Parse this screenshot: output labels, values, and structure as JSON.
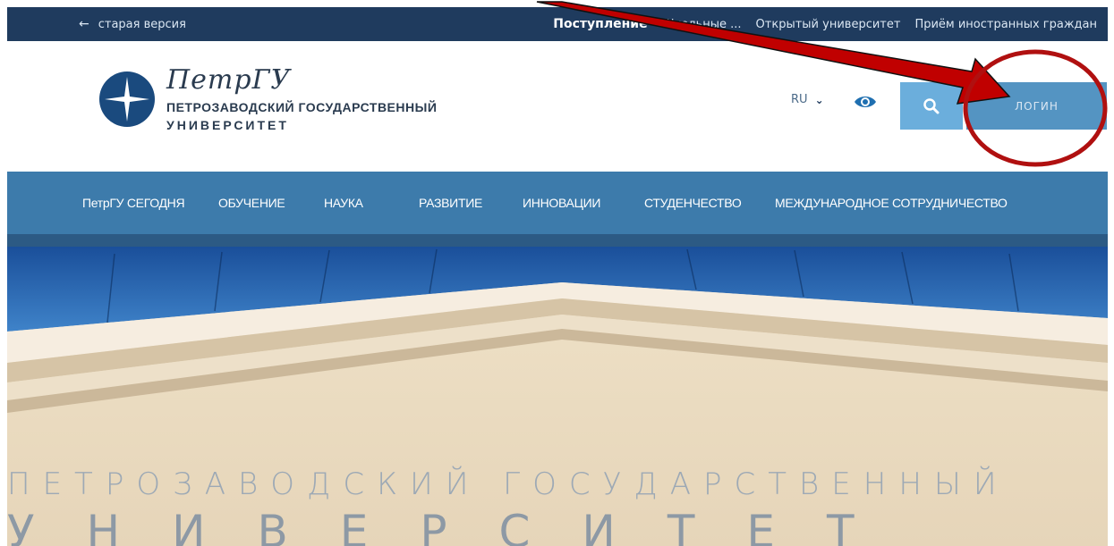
{
  "topbar": {
    "old_version": "старая версия",
    "links": [
      "Поступление",
      "Школьные ...",
      "Открытый университет",
      "Приём иностранных граждан"
    ]
  },
  "brand": {
    "script": "ПетрГУ",
    "line1": "ПЕТРОЗАВОДСКИЙ ГОСУДАРСТВЕННЫЙ",
    "line2": "УНИВЕРСИТЕТ"
  },
  "header": {
    "lang": "RU",
    "login_label": "ЛОГИН"
  },
  "nav": {
    "items": [
      "ПетрГУ СЕГОДНЯ",
      "ОБУЧЕНИЕ",
      "НАУКА",
      "РАЗВИТИЕ",
      "ИННОВАЦИИ",
      "СТУДЕНЧЕСТВО",
      "МЕЖДУНАРОДНОЕ СОТРУДНИЧЕСТВО"
    ]
  },
  "hero": {
    "line1": "ПЕТРОЗАВОДСКИЙ ГОСУДАРСТВЕННЫЙ",
    "line2": "УНИВЕРСИТЕТ"
  },
  "icons": {
    "back": "arrow-left-icon",
    "chevron": "chevron-down-icon",
    "eye": "eye-icon",
    "search": "search-icon",
    "logo": "star-compass-icon"
  },
  "colors": {
    "topbar": "#1f3b5e",
    "nav": "#3d7bab",
    "search": "#6baedc",
    "login": "#5494c2",
    "annotation": "#b01010"
  }
}
